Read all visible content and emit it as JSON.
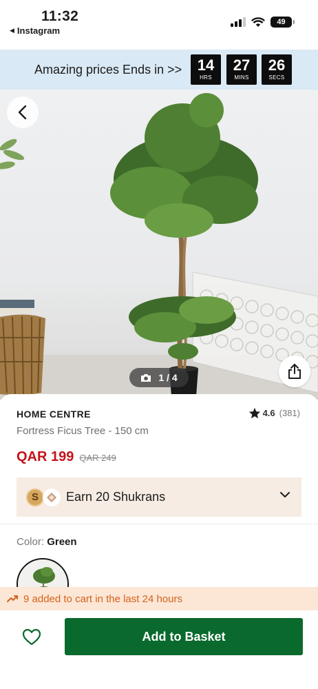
{
  "status_bar": {
    "time": "11:32",
    "back_app": "Instagram",
    "battery": "49"
  },
  "promo": {
    "text": "Amazing prices Ends in >>",
    "timers": [
      {
        "value": "14",
        "unit": "HRS"
      },
      {
        "value": "27",
        "unit": "MINS"
      },
      {
        "value": "26",
        "unit": "SECS"
      }
    ]
  },
  "gallery": {
    "counter": "1 / 4",
    "icons": [
      "back-arrow-icon",
      "share-icon",
      "camera-icon"
    ]
  },
  "product": {
    "brand": "HOME CENTRE",
    "rating": "4.6",
    "reviews": "(381)",
    "name": "Fortress Ficus Tree - 150 cm",
    "price": "QAR 199",
    "old_price": "QAR 249"
  },
  "shukran": {
    "coin_letter": "S",
    "text": "Earn 20 Shukrans"
  },
  "color": {
    "label": "Color:",
    "value": "Green"
  },
  "cart_note": "9 added to cart in the last 24 hours",
  "actions": {
    "add_to_basket": "Add to Basket"
  },
  "colors": {
    "price_red": "#c2131b",
    "cta_green": "#0a6a2d",
    "promo_bg": "#d9e9f5",
    "note_orange": "#d5621a"
  }
}
